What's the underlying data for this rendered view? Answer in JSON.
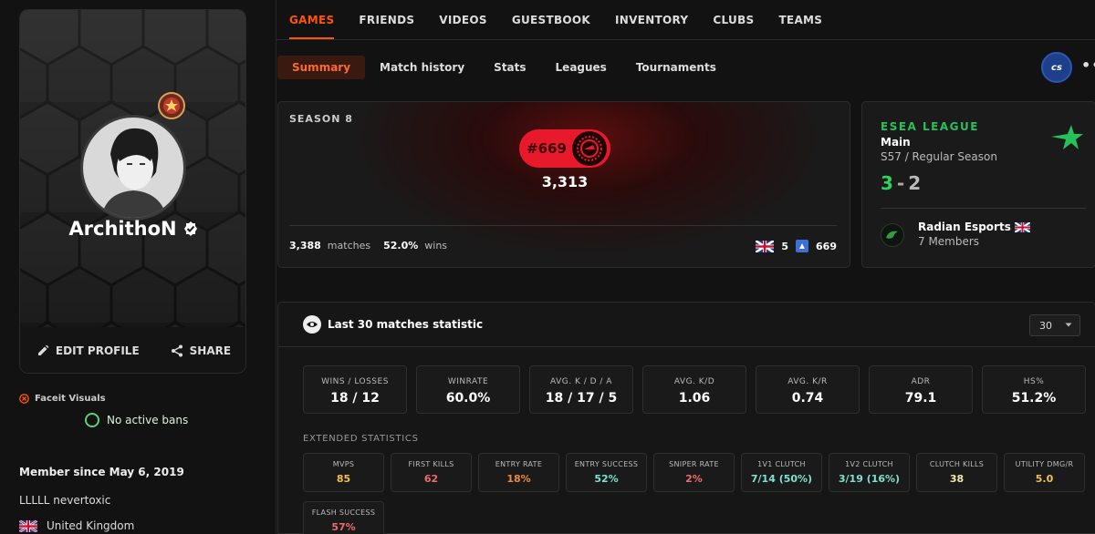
{
  "profile": {
    "username": "ArchithoN",
    "edit_label": "EDIT PROFILE",
    "share_label": "SHARE",
    "visuals_label": "Faceit Visuals",
    "bans_label": "No active bans",
    "member_since": "Member since May 6, 2019",
    "bio": "LLLLL nevertoxic",
    "country": "United Kingdom"
  },
  "nav": {
    "tabs": [
      "GAMES",
      "FRIENDS",
      "VIDEOS",
      "GUESTBOOK",
      "INVENTORY",
      "CLUBS",
      "TEAMS"
    ],
    "active": "GAMES"
  },
  "subnav": {
    "tabs": [
      "Summary",
      "Match history",
      "Stats",
      "Leagues",
      "Tournaments"
    ],
    "active": "Summary",
    "game_badge": "cs",
    "more": "•••"
  },
  "season": {
    "label": "SEASON 8",
    "rank": "#669",
    "elo": "3,313",
    "matches_value": "3,388",
    "matches_label": "matches",
    "wins_value": "52.0%",
    "wins_label": "wins",
    "country_rank": "5",
    "region_rank": "669"
  },
  "league": {
    "title": "ESEA LEAGUE",
    "division": "Main",
    "season": "S57 / Regular Season",
    "wins": "3",
    "dash": "-",
    "losses": "2",
    "team_name": "Radian Esports",
    "team_members": "7 Members"
  },
  "stats": {
    "title": "Last 30 matches statistic",
    "select_value": "30",
    "main": [
      {
        "label": "WINS / LOSSES",
        "value": "18 / 12"
      },
      {
        "label": "WINRATE",
        "value": "60.0%"
      },
      {
        "label": "AVG. K / D / A",
        "value": "18 / 17 / 5"
      },
      {
        "label": "AVG. K/D",
        "value": "1.06"
      },
      {
        "label": "AVG. K/R",
        "value": "0.74"
      },
      {
        "label": "ADR",
        "value": "79.1"
      },
      {
        "label": "HS%",
        "value": "51.2%"
      }
    ],
    "extended_label": "EXTENDED STATISTICS",
    "extended": [
      {
        "label": "MVPS",
        "value": "85",
        "color": "#f2c24a"
      },
      {
        "label": "FIRST KILLS",
        "value": "62",
        "color": "#ef6b6b"
      },
      {
        "label": "ENTRY RATE",
        "value": "18%",
        "color": "#f08a3a"
      },
      {
        "label": "ENTRY SUCCESS",
        "value": "52%",
        "color": "#7fe0d4"
      },
      {
        "label": "SNIPER RATE",
        "value": "2%",
        "color": "#ef6b6b"
      },
      {
        "label": "1V1 CLUTCH",
        "value": "7/14 (50%)",
        "color": "#7fe0d4"
      },
      {
        "label": "1V2 CLUTCH",
        "value": "3/19 (16%)",
        "color": "#7fe0d4"
      },
      {
        "label": "CLUTCH KILLS",
        "value": "38",
        "color": "#f2e7a8"
      },
      {
        "label": "UTILITY DMG/R",
        "value": "5.0",
        "color": "#f2c24a"
      },
      {
        "label": "FLASH SUCCESS",
        "value": "57%",
        "color": "#ef6b6b"
      }
    ]
  },
  "colors": {
    "accent": "#ff5500",
    "rank_red": "#e8192a",
    "esea_green": "#26c15b"
  }
}
